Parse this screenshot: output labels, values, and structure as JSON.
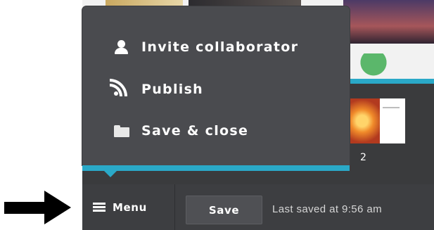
{
  "menu": {
    "items": [
      {
        "label": "Invite collaborator",
        "icon": "user-icon"
      },
      {
        "label": "Publish",
        "icon": "rss-icon"
      },
      {
        "label": "Save & close",
        "icon": "folder-icon"
      }
    ]
  },
  "pages": {
    "current_page_number": "2"
  },
  "toolbar": {
    "menu_label": "Menu",
    "save_label": "Save",
    "status_text": "Last saved at 9:56 am"
  },
  "colors": {
    "accent": "#2aa9c8",
    "panel": "#4a4b4f",
    "toolbar": "#3d3e41"
  }
}
